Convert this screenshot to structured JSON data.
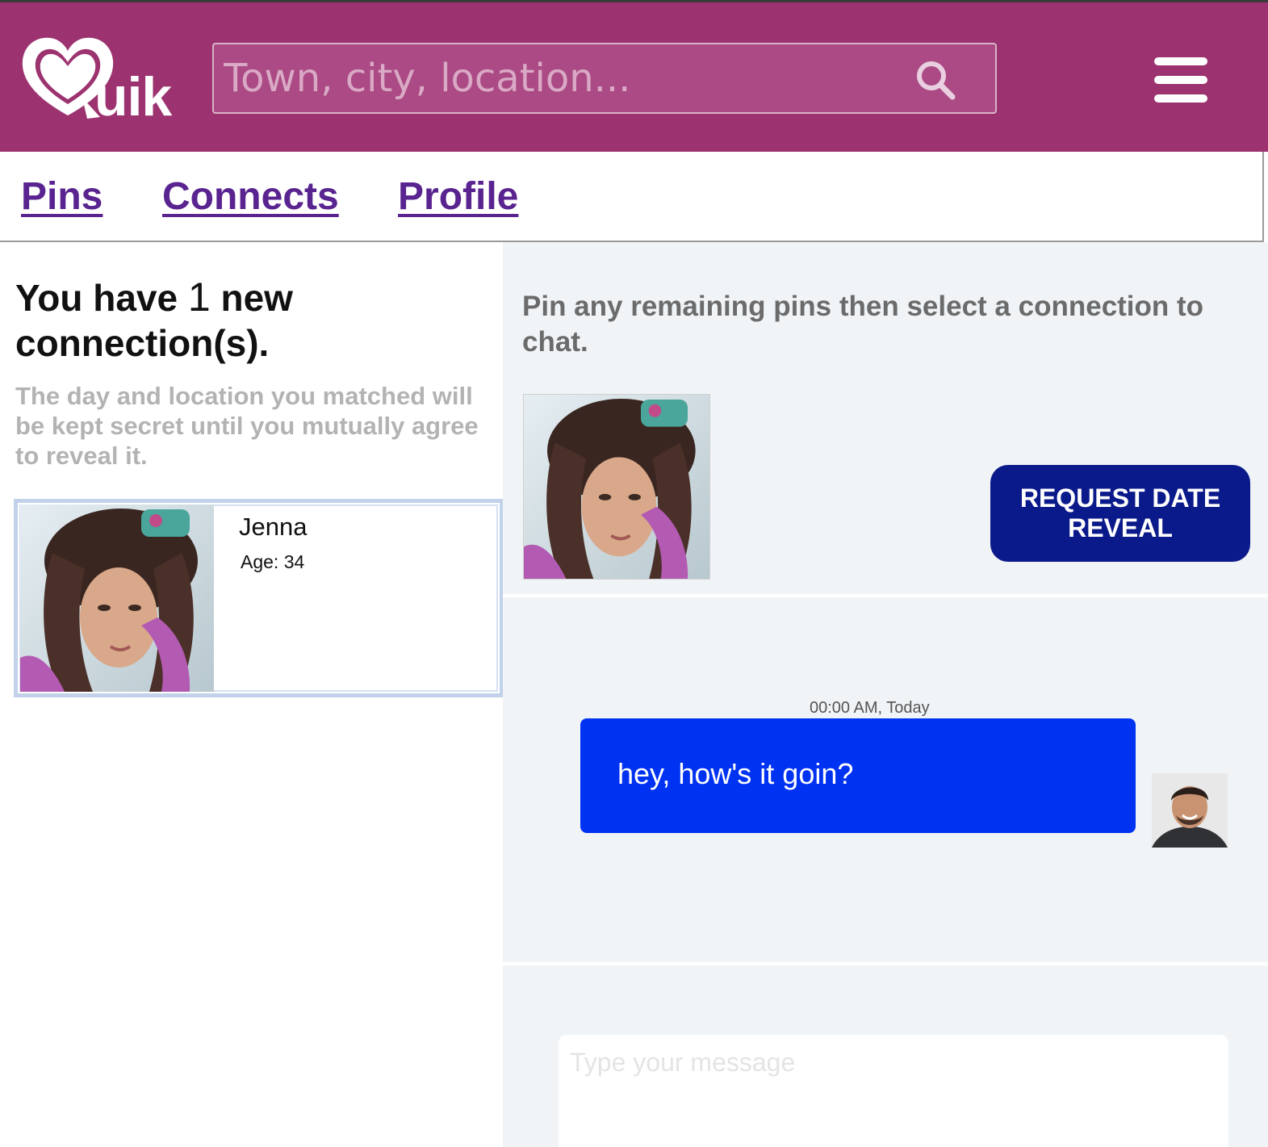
{
  "header": {
    "logo_text": "uik",
    "search_placeholder": "Town, city, location...",
    "search_value": "",
    "brand_color": "#9c3370"
  },
  "nav": {
    "items": [
      {
        "label": "Pins"
      },
      {
        "label": "Connects"
      },
      {
        "label": "Profile"
      }
    ]
  },
  "connections": {
    "headline_prefix": "You have",
    "count": "1",
    "headline_suffix": "new connection(s).",
    "subtext": "The day and location you matched will be kept secret until you mutually agree to reveal it.",
    "list": [
      {
        "name": "Jenna",
        "age_label": "Age: 34"
      }
    ]
  },
  "chat": {
    "instructions": "Pin any remaining pins then select a connection to chat.",
    "reveal_button_label": "REQUEST DATE REVEAL",
    "messages": [
      {
        "timestamp": "00:00 AM, Today",
        "text": "hey, how's it goin?"
      }
    ],
    "composer_placeholder": "Type your message",
    "bubble_color": "#0032f2",
    "button_color": "#0b1a8a"
  }
}
